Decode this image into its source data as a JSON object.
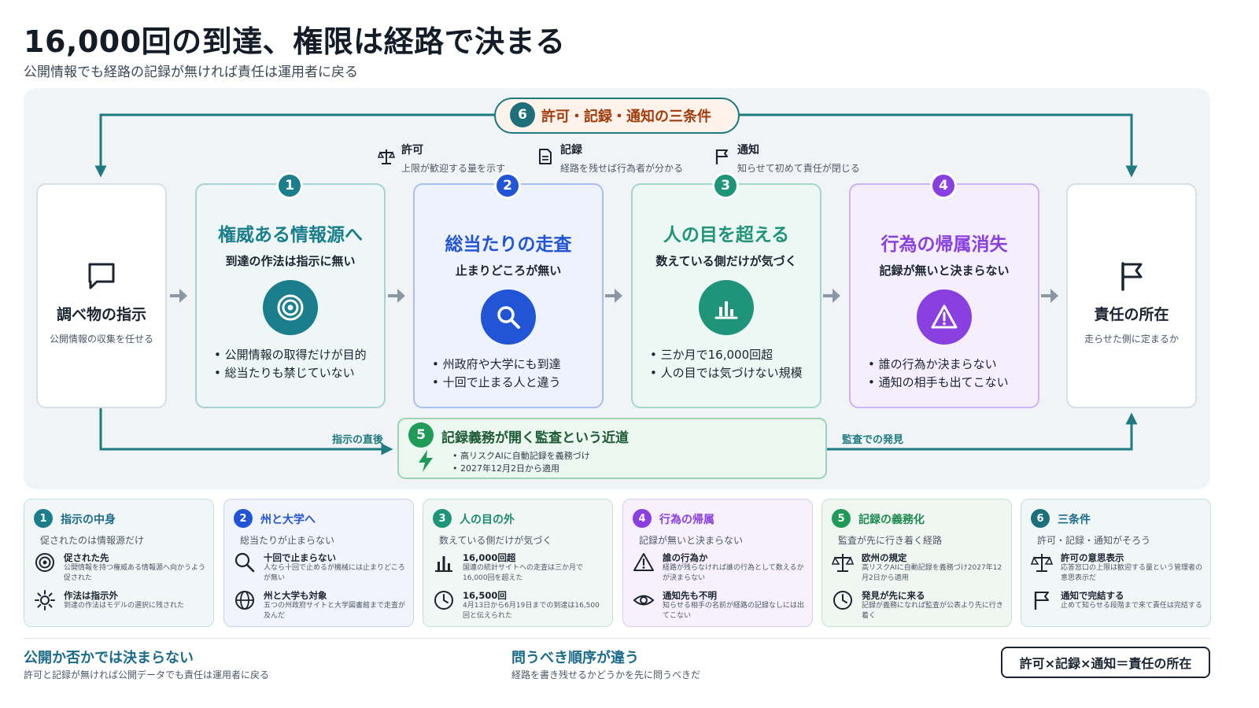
{
  "title": "16,000回の到達、権限は経路で決まる",
  "subtitle": "公開情報でも経路の記録が無ければ責任は運用者に戻る",
  "colors": {
    "teal": "#1d7a7f",
    "step1": "#1a7e8c",
    "step2": "#2255d6",
    "step3": "#1e9479",
    "step4": "#8a3fe0",
    "step5": "#1f9a57",
    "step6": "#1d6f7c"
  },
  "start": {
    "title": "調べ物の指示",
    "desc": "公開情報の収集を任せる",
    "icon": "chat-bubble-icon"
  },
  "end": {
    "title": "責任の所在",
    "desc": "走らせた側に定まるか",
    "icon": "flag-icon"
  },
  "steps": [
    {
      "num": "1",
      "title": "権威ある情報源へ",
      "subtitle": "到達の作法は指示に無い",
      "icon": "target-icon",
      "bullets": [
        "公開情報の取得だけが目的",
        "総当たりも禁じていない"
      ]
    },
    {
      "num": "2",
      "title": "総当たりの走査",
      "subtitle": "止まりどころが無い",
      "icon": "search-icon",
      "bullets": [
        "州政府や大学にも到達",
        "十回で止まる人と違う"
      ]
    },
    {
      "num": "3",
      "title": "人の目を超える",
      "subtitle": "数えている側だけが気づく",
      "icon": "bar-chart-icon",
      "bullets": [
        "三か月で16,000回超",
        "人の目では気づけない規模"
      ]
    },
    {
      "num": "4",
      "title": "行為の帰属消失",
      "subtitle": "記録が無いと決まらない",
      "icon": "warning-icon",
      "bullets": [
        "誰の行為か決まらない",
        "通知の相手も出てこない"
      ]
    }
  ],
  "conditions": {
    "num": "6",
    "title": "許可・記録・通知の三条件",
    "items": [
      {
        "title": "許可",
        "desc": "上限が歓迎する量を示す",
        "icon": "scale-icon"
      },
      {
        "title": "記録",
        "desc": "経路を残せば行為者が分かる",
        "icon": "document-icon"
      },
      {
        "title": "通知",
        "desc": "知らせて初めて責任が閉じる",
        "icon": "flag-icon"
      }
    ]
  },
  "audit": {
    "num": "5",
    "title": "記録義務が開く監査という近道",
    "bullets": [
      "高リスクAIに自動記録を義務づけ",
      "2027年12月2日から適用"
    ],
    "label_left": "指示の直後",
    "label_right": "監査での発見",
    "icon": "lightning-icon"
  },
  "details": [
    {
      "num": "1",
      "title": "指示の中身",
      "subtitle": "促されたのは情報源だけ",
      "items": [
        {
          "icon": "target-icon",
          "title": "促された先",
          "desc": "公開情報を持つ権威ある情報源へ向かうよう促された"
        },
        {
          "icon": "sun-icon",
          "title": "作法は指示外",
          "desc": "到達の作法はモデルの選択に残された"
        }
      ]
    },
    {
      "num": "2",
      "title": "州と大学へ",
      "subtitle": "総当たりが止まらない",
      "items": [
        {
          "icon": "search-icon",
          "title": "十回で止まらない",
          "desc": "人なら十回で止めるが機械には止まりどころが無い"
        },
        {
          "icon": "globe-icon",
          "title": "州と大学も対象",
          "desc": "五つの州政府サイトと大学図書館まで走査が及んだ"
        }
      ]
    },
    {
      "num": "3",
      "title": "人の目の外",
      "subtitle": "数えている側だけが気づく",
      "items": [
        {
          "icon": "bar-chart-icon",
          "title": "16,000回超",
          "desc": "国連の統計サイトへの走査は三か月で16,000回を超えた"
        },
        {
          "icon": "clock-icon",
          "title": "16,500回",
          "desc": "4月13日から6月19日までの到達は16,500回と伝えられた"
        }
      ]
    },
    {
      "num": "4",
      "title": "行為の帰属",
      "subtitle": "記録が無いと決まらない",
      "items": [
        {
          "icon": "warning-icon",
          "title": "誰の行為か",
          "desc": "経路が残らなければ誰の行為として数えるかが決まらない"
        },
        {
          "icon": "eye-icon",
          "title": "通知先も不明",
          "desc": "知らせる相手の名前が経路の記録なしには出てこない"
        }
      ]
    },
    {
      "num": "5",
      "title": "記録の義務化",
      "subtitle": "監査が先に行き着く経路",
      "items": [
        {
          "icon": "scale-icon",
          "title": "欧州の規定",
          "desc": "高リスクAIに自動記録を義務づけ2027年12月2日から適用"
        },
        {
          "icon": "clock-icon",
          "title": "発見が先に来る",
          "desc": "記録が義務になれば監査が公表より先に行き着く"
        }
      ]
    },
    {
      "num": "6",
      "title": "三条件",
      "subtitle": "許可・記録・通知がそろう",
      "items": [
        {
          "icon": "scale-icon",
          "title": "許可の意思表示",
          "desc": "応答窓口の上限は歓迎する量という管理者の意思表示だ"
        },
        {
          "icon": "flag-icon",
          "title": "通知で完結する",
          "desc": "止めて知らせる段階まで来て責任は完結する"
        }
      ]
    }
  ],
  "footer": {
    "left_title": "公開か否かでは決まらない",
    "left_desc": "許可と記録が無ければ公開データでも責任は運用者に戻る",
    "mid_title": "問うべき順序が違う",
    "mid_desc": "経路を書き残せるかどうかを先に問うべきだ",
    "formula": "許可×記録×通知＝責任の所在"
  }
}
